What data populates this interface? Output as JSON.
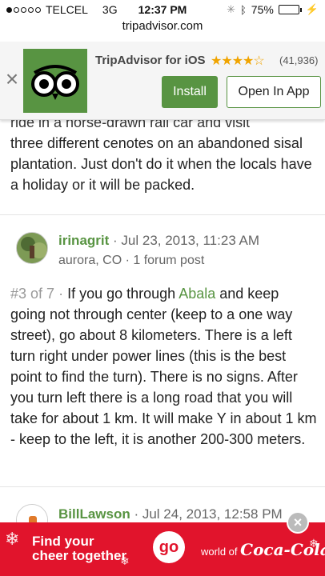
{
  "status_bar": {
    "carrier": "TELCEL",
    "network": "3G",
    "time": "12:37 PM",
    "battery": "75%",
    "battery_level": 0.75,
    "signal_bars_filled": 1,
    "signal_bars_total": 5,
    "icons": [
      "signal-dots",
      "activity-spinner-icon",
      "bluetooth-icon",
      "battery-icon",
      "charging-bolt-icon"
    ]
  },
  "url_bar": {
    "domain": "tripadvisor.com"
  },
  "app_banner": {
    "app_name": "TripAdvisor for iOS",
    "rating_stars": "★★★★☆",
    "rating": 4.5,
    "review_count": "(41,936)",
    "install_label": "Install",
    "open_label": "Open In App",
    "close_glyph": "×",
    "colors": {
      "brand_green": "#589442"
    }
  },
  "previous_post": {
    "partial_line": "ride in a horse-drawn rail car and visit",
    "text": "three different cenotes on an abandoned sisal plantation. Just don't do it when the locals have a holiday or it will be packed."
  },
  "posts": [
    {
      "username": "irinagrit",
      "date": "· Jul 23, 2013, 11:23 AM",
      "location": "aurora, CO · 1 forum post",
      "post_number": "#3 of 7",
      "body_before_link": "If you go through",
      "link_text": "Abala",
      "body_after_link": "and keep going not through center (keep to a one way street), go about 8 kilometers. There is a left turn right under power lines (this is the best point to find the turn). There is no signs. After you turn left there is a long road that you will take for about 1 km. It will make Y in about 1 km - keep to the left, it is another 200-300 meters."
    },
    {
      "username": "BillLawson",
      "date": "· Jul 24, 2013, 12:58 PM"
    }
  ],
  "ad": {
    "headline_line1": "Find your",
    "headline_line2": "cheer together",
    "go_label": "go",
    "brand_prefix": "world of",
    "brand_name": "Coca-Cola",
    "close_glyph": "×",
    "colors": {
      "background": "#e1142c"
    }
  }
}
